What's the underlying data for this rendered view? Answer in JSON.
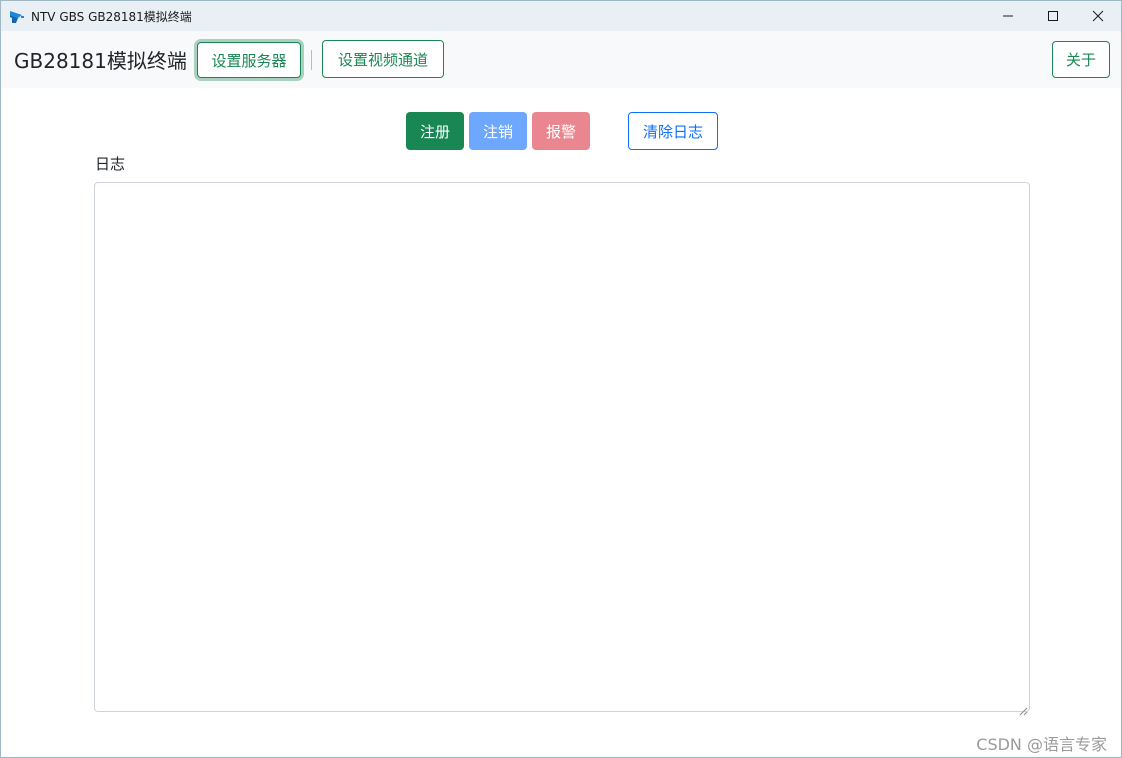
{
  "window": {
    "title": "NTV GBS GB28181模拟终端",
    "controls": {
      "minimize_icon": "minimize-icon",
      "maximize_icon": "maximize-icon",
      "close_icon": "close-icon"
    }
  },
  "navbar": {
    "brand": "GB28181模拟终端",
    "set_server": "设置服务器",
    "set_channel": "设置视频通道",
    "about": "关于"
  },
  "actions": {
    "register": "注册",
    "logout": "注销",
    "alarm": "报警",
    "clear_log": "清除日志"
  },
  "log": {
    "label": "日志",
    "value": ""
  },
  "watermark": "CSDN @语言专家",
  "colors": {
    "success": "#198754",
    "primary": "#0d6efd",
    "primary_light": "#6ea8fe",
    "danger_light": "#ea868f",
    "titlebar_bg": "#e8f0f5",
    "navbar_bg": "#f8f9fa"
  }
}
